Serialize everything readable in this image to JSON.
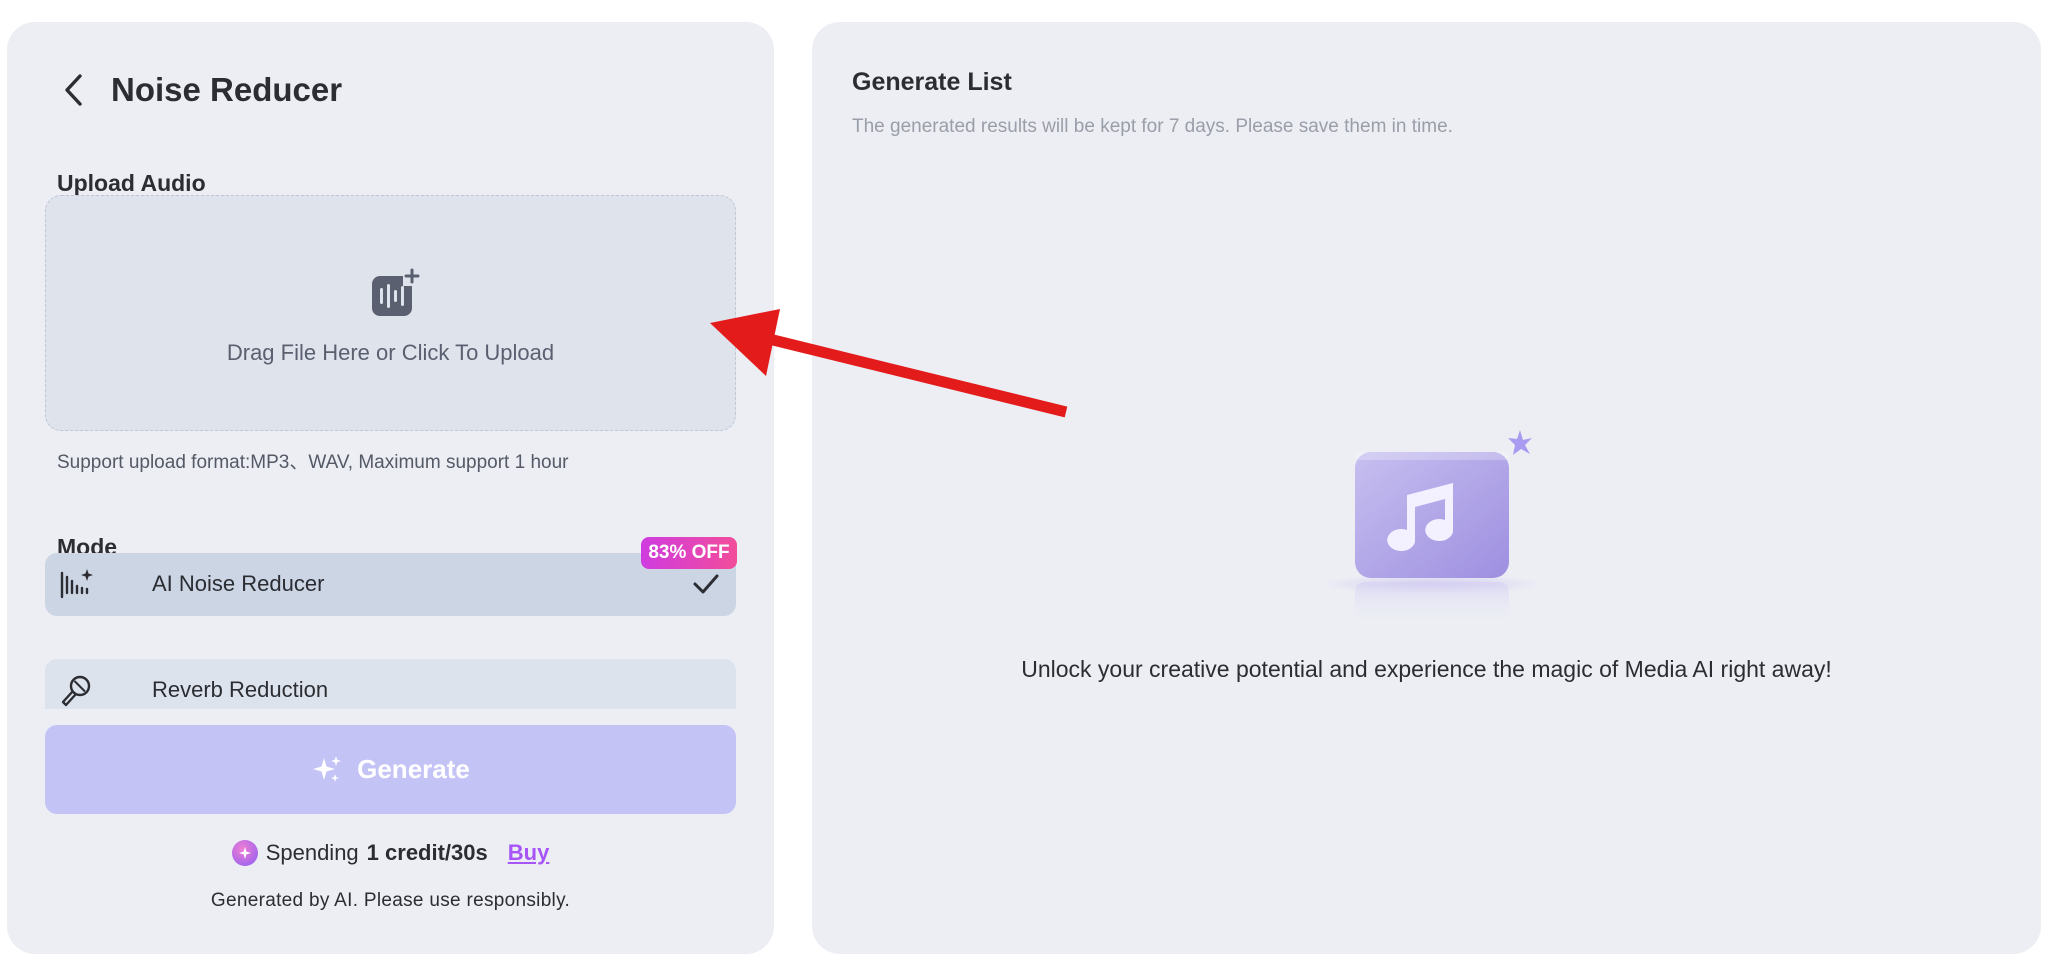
{
  "left_panel": {
    "title": "Noise Reducer",
    "back_icon": "chevron-left-icon",
    "upload": {
      "section_label": "Upload Audio",
      "icon": "audio-upload-icon",
      "drop_text": "Drag File Here or Click To Upload",
      "format_note": "Support upload format:MP3、WAV, Maximum support 1 hour"
    },
    "mode": {
      "section_label": "Mode",
      "badge": "83% OFF",
      "items": [
        {
          "label": "AI Noise Reducer",
          "icon": "waveform-sparkle-icon",
          "selected": true
        },
        {
          "label": "Reverb Reduction",
          "icon": "microphone-icon",
          "selected": false
        }
      ]
    },
    "generate_button": {
      "label": "Generate",
      "icon": "sparkle-icon"
    },
    "credits": {
      "prefix": "Spending",
      "amount": "1 credit/30s",
      "buy_label": "Buy",
      "icon": "credit-coin-icon"
    },
    "disclaimer": "Generated by AI. Please use responsibly."
  },
  "right_panel": {
    "title": "Generate List",
    "subtitle": "The generated results will be kept for 7 days. Please save them in time.",
    "empty_state": {
      "icon": "music-note-icon",
      "message": "Unlock your creative potential and experience the magic of Media AI right away!"
    }
  },
  "annotation": {
    "type": "red-arrow",
    "color": "#e31b1b"
  },
  "colors": {
    "panel_bg": "#eceef4",
    "upload_bg": "#dee3ec",
    "selected_mode_bg": "#cbd5e4",
    "generate_bg": "#c4c3f6",
    "badge_gradient": [
      "#cf3be0",
      "#f24d9a"
    ],
    "buy_link": "#a855f7"
  }
}
